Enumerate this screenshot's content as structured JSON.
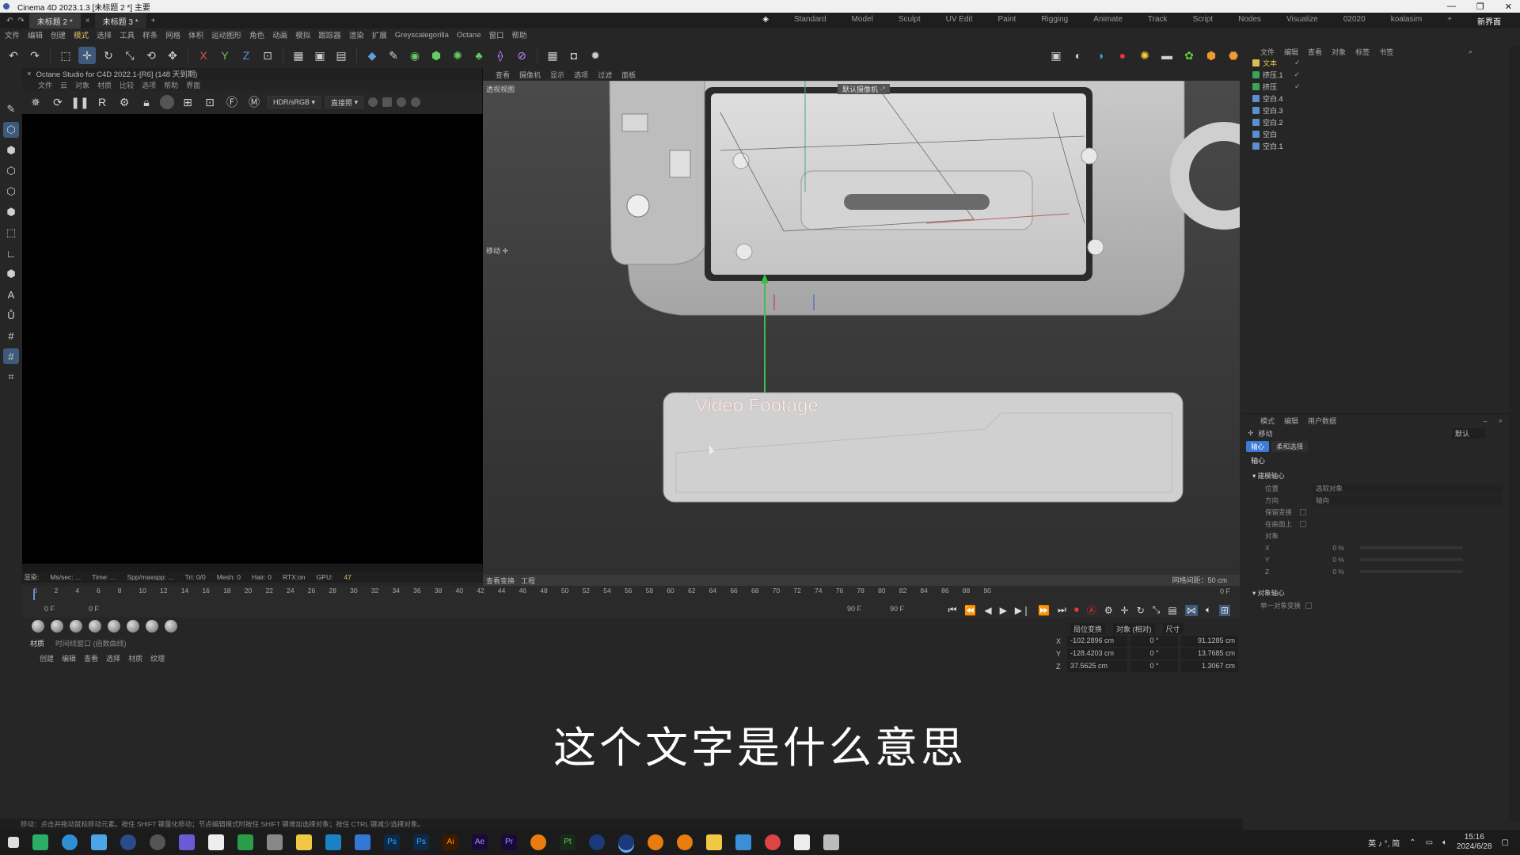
{
  "window": {
    "title": "Cinema 4D 2023.1.3  [未标题 2 *]  主要"
  },
  "doc_tabs": [
    "未标题 2 *",
    "未标题 3 *"
  ],
  "layouts": [
    "Standard",
    "Model",
    "Sculpt",
    "UV Edit",
    "Paint",
    "Rigging",
    "Animate",
    "Track",
    "Script",
    "Nodes",
    "Visualize",
    "02020",
    "koalasim",
    "新界面"
  ],
  "menu": [
    "文件",
    "编辑",
    "创建",
    "模式",
    "选择",
    "工具",
    "样条",
    "网格",
    "体积",
    "运动图形",
    "角色",
    "动画",
    "模拟",
    "跟踪器",
    "渲染",
    "扩展",
    "Greyscalegorilla",
    "Octane",
    "窗口",
    "帮助"
  ],
  "octane": {
    "title": "Octane Studio for C4D 2022.1-[R6] (148 天到期)",
    "menu": [
      "文件",
      "云",
      "对象",
      "材质",
      "比较",
      "选项",
      "帮助",
      "界面"
    ],
    "color_mode": "HDR/sRGB",
    "render_mode": "直接照",
    "status": [
      "渲染:",
      "Ms/sec: ...",
      "Time: ...",
      "Spp/maxspp: ...",
      "Tri: 0/0",
      "Mesh: 0",
      "Hair: 0",
      "RTX:on",
      "GPU:",
      "47"
    ]
  },
  "viewport": {
    "menu": [
      "查看",
      "摄像机",
      "显示",
      "选项",
      "过滤",
      "面板"
    ],
    "label": "透视视图",
    "camera": "默认摄像机 ·°",
    "move": "移动 ✛",
    "bottom_left": [
      "查看变换",
      "工程"
    ],
    "grid": "网格间距：50 cm",
    "scene_text": "Video Footage"
  },
  "timeline": {
    "ticks": [
      "0",
      "2",
      "4",
      "6",
      "8",
      "10",
      "12",
      "14",
      "16",
      "18",
      "20",
      "22",
      "24",
      "26",
      "28",
      "30",
      "32",
      "34",
      "36",
      "38",
      "40",
      "42",
      "44",
      "46",
      "48",
      "50",
      "52",
      "54",
      "56",
      "58",
      "60",
      "62",
      "64",
      "66",
      "68",
      "70",
      "72",
      "74",
      "76",
      "78",
      "80",
      "82",
      "84",
      "86",
      "88",
      "90"
    ],
    "current": "0 F",
    "start": "0 F",
    "start2": "0 F",
    "end": "90 F",
    "end2": "90 F"
  },
  "materials": {
    "tabs": [
      "材质",
      "时间线窗口 (函数曲线)"
    ],
    "menu": [
      "创建",
      "编辑",
      "查看",
      "选择",
      "材质",
      "纹理"
    ]
  },
  "coords": {
    "header": [
      "局位变换",
      "对象 (相对)",
      "尺寸"
    ],
    "rows": [
      {
        "axis": "X",
        "pos": "-102.2896 cm",
        "rot": "0 °",
        "size": "91.1285 cm"
      },
      {
        "axis": "Y",
        "pos": "-128.4203 cm",
        "rot": "0 °",
        "size": "13.7685 cm"
      },
      {
        "axis": "Z",
        "pos": "37.5625 cm",
        "rot": "0 °",
        "size": "1.3067 cm"
      }
    ]
  },
  "object_manager": {
    "menu": [
      "文件",
      "编辑",
      "查看",
      "对象",
      "标签",
      "书签"
    ],
    "items": [
      {
        "name": "文本",
        "type": "text",
        "selected": true
      },
      {
        "name": "挤压.1",
        "type": "extrude"
      },
      {
        "name": "挤压",
        "type": "extrude"
      },
      {
        "name": "空白.4",
        "type": "null"
      },
      {
        "name": "空白.3",
        "type": "null"
      },
      {
        "name": "空白.2",
        "type": "null"
      },
      {
        "name": "空白",
        "type": "null"
      },
      {
        "name": "空白.1",
        "type": "null"
      }
    ]
  },
  "attribute_manager": {
    "menu": [
      "模式",
      "编辑",
      "用户数据"
    ],
    "tool": "移动",
    "preset": "默认",
    "tabs": [
      "轴心",
      "柔和选择"
    ],
    "section": "轴心",
    "group1": "建模轴心",
    "rows": [
      {
        "label": "位置",
        "value": "选取对象"
      },
      {
        "label": "方向",
        "value": "轴向"
      },
      {
        "label": "保留变换",
        "value": ""
      },
      {
        "label": "在曲面上",
        "value": ""
      },
      {
        "label": "对象",
        "value": ""
      },
      {
        "label": "X",
        "value": "0 %"
      },
      {
        "label": "Y",
        "value": "0 %"
      },
      {
        "label": "Z",
        "value": "0 %"
      }
    ],
    "group2": "对象轴心",
    "single": "单一对象变换"
  },
  "subtitle": "这个文字是什么意思",
  "statusbar": "移动：点击并拖动鼠标移动元素。按住 SHIFT 键量化移动；节点编辑模式时按住 SHIFT 键增加选择对象；按住 CTRL 键减少选择对象。",
  "taskbar": {
    "lang": "英 ♪ °, 简",
    "time": "15:16",
    "date": "2024/6/28"
  },
  "colors": {
    "accent": "#3e5a7a",
    "selection": "#3b7bd6",
    "green": "#3aa655"
  }
}
